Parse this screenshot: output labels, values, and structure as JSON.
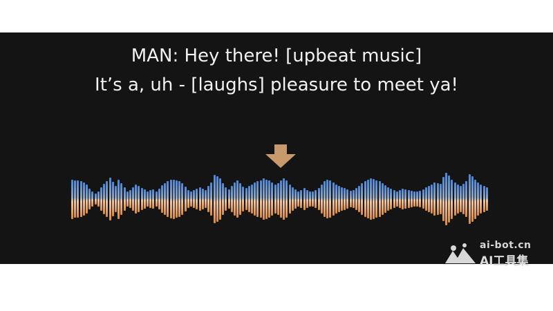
{
  "caption": {
    "line1": "MAN: Hey there! [upbeat music]",
    "line2": "It’s a, uh - [laughs] pleasure to meet ya!"
  },
  "arrow": {
    "icon": "down-arrow-icon",
    "color": "#c89a6b"
  },
  "waveform": {
    "top_color": "#4a86d8",
    "bottom_color": "#d98a3e",
    "levels": [
      0.75,
      0.72,
      0.7,
      0.68,
      0.62,
      0.55,
      0.4,
      0.28,
      0.22,
      0.3,
      0.45,
      0.58,
      0.68,
      0.82,
      0.65,
      0.5,
      0.75,
      0.6,
      0.45,
      0.3,
      0.35,
      0.45,
      0.55,
      0.5,
      0.42,
      0.38,
      0.3,
      0.35,
      0.38,
      0.3,
      0.4,
      0.52,
      0.6,
      0.68,
      0.74,
      0.75,
      0.72,
      0.68,
      0.6,
      0.48,
      0.35,
      0.3,
      0.35,
      0.4,
      0.45,
      0.4,
      0.35,
      0.5,
      0.62,
      0.92,
      0.86,
      0.8,
      0.6,
      0.45,
      0.38,
      0.5,
      0.62,
      0.7,
      0.6,
      0.48,
      0.42,
      0.5,
      0.55,
      0.62,
      0.68,
      0.72,
      0.8,
      0.75,
      0.7,
      0.62,
      0.55,
      0.6,
      0.72,
      0.8,
      0.7,
      0.55,
      0.45,
      0.38,
      0.3,
      0.35,
      0.42,
      0.35,
      0.3,
      0.28,
      0.35,
      0.42,
      0.55,
      0.68,
      0.74,
      0.7,
      0.62,
      0.55,
      0.5,
      0.45,
      0.42,
      0.38,
      0.32,
      0.35,
      0.42,
      0.5,
      0.6,
      0.68,
      0.74,
      0.78,
      0.76,
      0.72,
      0.68,
      0.6,
      0.52,
      0.45,
      0.4,
      0.35,
      0.3,
      0.34,
      0.4,
      0.38,
      0.35,
      0.32,
      0.3,
      0.28,
      0.32,
      0.38,
      0.44,
      0.5,
      0.56,
      0.62,
      0.6,
      0.58,
      0.85,
      1.0,
      0.9,
      0.75,
      0.62,
      0.55,
      0.5,
      0.58,
      0.68,
      0.95,
      0.88,
      0.75,
      0.62,
      0.55,
      0.5,
      0.45
    ]
  },
  "watermark": {
    "icon": "ai-bot-logo-icon",
    "domain": "ai-bot.cn",
    "title": "AI工具集"
  }
}
